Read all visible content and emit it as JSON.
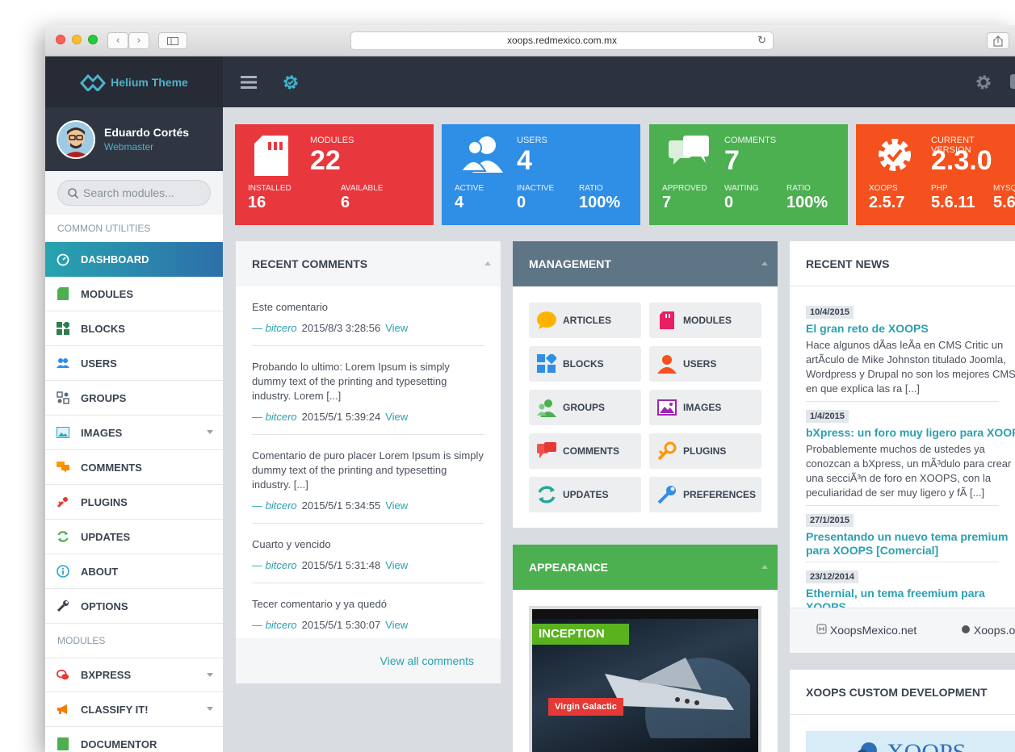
{
  "browser": {
    "url": "xoops.redmexico.com.mx"
  },
  "brand": {
    "name": "Helium Theme"
  },
  "profile": {
    "name": "Eduardo Cortés",
    "role": "Webmaster"
  },
  "search": {
    "placeholder": "Search modules..."
  },
  "sidebar": {
    "section1": "COMMON UTILITIES",
    "items": [
      {
        "label": "DASHBOARD",
        "icon": "dashboard-icon"
      },
      {
        "label": "MODULES",
        "icon": "modules-icon"
      },
      {
        "label": "BLOCKS",
        "icon": "blocks-icon"
      },
      {
        "label": "USERS",
        "icon": "users-icon"
      },
      {
        "label": "GROUPS",
        "icon": "groups-icon"
      },
      {
        "label": "IMAGES",
        "icon": "images-icon"
      },
      {
        "label": "COMMENTS",
        "icon": "comments-icon"
      },
      {
        "label": "PLUGINS",
        "icon": "plugins-icon"
      },
      {
        "label": "UPDATES",
        "icon": "updates-icon"
      },
      {
        "label": "ABOUT",
        "icon": "about-icon"
      },
      {
        "label": "OPTIONS",
        "icon": "options-icon"
      }
    ],
    "section2": "MODULES",
    "modules": [
      {
        "label": "BXPRESS",
        "icon": "bxpress-icon"
      },
      {
        "label": "CLASSIFY IT!",
        "icon": "classify-icon"
      },
      {
        "label": "DOCUMENTOR",
        "icon": "documentor-icon"
      }
    ]
  },
  "stats": {
    "modules": {
      "label": "MODULES",
      "value": "22",
      "installed_label": "INSTALLED",
      "installed": "16",
      "available_label": "AVAILABLE",
      "available": "6",
      "color": "#e8383d"
    },
    "users": {
      "label": "USERS",
      "value": "4",
      "active_label": "ACTIVE",
      "active": "4",
      "inactive_label": "INACTIVE",
      "inactive": "0",
      "ratio_label": "RATIO",
      "ratio": "100%",
      "color": "#2f8ee6"
    },
    "comments": {
      "label": "COMMENTS",
      "value": "7",
      "approved_label": "APPROVED",
      "approved": "7",
      "waiting_label": "WAITING",
      "waiting": "0",
      "ratio_label": "RATIO",
      "ratio": "100%",
      "color": "#4caf50"
    },
    "version": {
      "label": "CURRENT VERSION",
      "value": "2.3.0",
      "xoops_label": "XOOPS",
      "xoops": "2.5.7",
      "php_label": "PHP",
      "php": "5.6.11",
      "mysql_label": "MYSQL",
      "mysql": "5.6",
      "color": "#f4511e"
    }
  },
  "recent_comments": {
    "title": "RECENT COMMENTS",
    "items": [
      {
        "text": "Este comentario",
        "author": "— bitcero",
        "date": "2015/8/3 3:28:56",
        "view": "View"
      },
      {
        "text": "Probando lo ultimo: Lorem Ipsum is simply dummy text of the printing and typesetting industry. Lorem [...]",
        "author": "— bitcero",
        "date": "2015/5/1 5:39:24",
        "view": "View"
      },
      {
        "text": "Comentario de puro placer Lorem Ipsum is simply dummy text of the printing and typesetting industry. [...]",
        "author": "— bitcero",
        "date": "2015/5/1 5:34:55",
        "view": "View"
      },
      {
        "text": "Cuarto y vencido",
        "author": "— bitcero",
        "date": "2015/5/1 5:31:48",
        "view": "View"
      },
      {
        "text": "Tecer comentario y ya quedó",
        "author": "— bitcero",
        "date": "2015/5/1 5:30:07",
        "view": "View"
      }
    ],
    "view_all": "View all comments"
  },
  "management": {
    "title": "MANAGEMENT",
    "buttons": [
      "ARTICLES",
      "MODULES",
      "BLOCKS",
      "USERS",
      "GROUPS",
      "IMAGES",
      "COMMENTS",
      "PLUGINS",
      "UPDATES",
      "PREFERENCES"
    ]
  },
  "appearance": {
    "title": "APPEARANCE",
    "thumb_title": "INCEPTION",
    "thumb_badge": "Virgin Galactic"
  },
  "recent_news": {
    "title": "RECENT NEWS",
    "items": [
      {
        "date": "10/4/2015",
        "title": "El gran reto de XOOPS",
        "text": [
          "Hace algunos dÃas leÃa en CMS Critic un",
          "artÃculo de Mike Johnston titulado Joomla,",
          "Wordpress y Drupal no son los mejores CMS",
          "en que explica las ra [...]"
        ]
      },
      {
        "date": "1/4/2015",
        "title": "bXpress: un foro muy ligero para XOOPS",
        "text": [
          "Probablemente muchos de ustedes ya",
          "conozcan a bXpress, un mÃ³dulo para crear",
          "una secciÃ³n de foro en XOOPS, con la",
          "peculiaridad de ser muy ligero y fÃ [...]"
        ]
      },
      {
        "date": "27/1/2015",
        "title": "Presentando un nuevo tema premium",
        "title2": "para XOOPS [Comercial]",
        "text": []
      },
      {
        "date": "23/12/2014",
        "title": "Ethernial, un tema freemium para",
        "title2": "XOOPS",
        "text": []
      }
    ],
    "links": [
      "XoopsMexico.net",
      "Xoops.org"
    ]
  },
  "custom_dev": {
    "title": "XOOPS CUSTOM DEVELOPMENT"
  }
}
